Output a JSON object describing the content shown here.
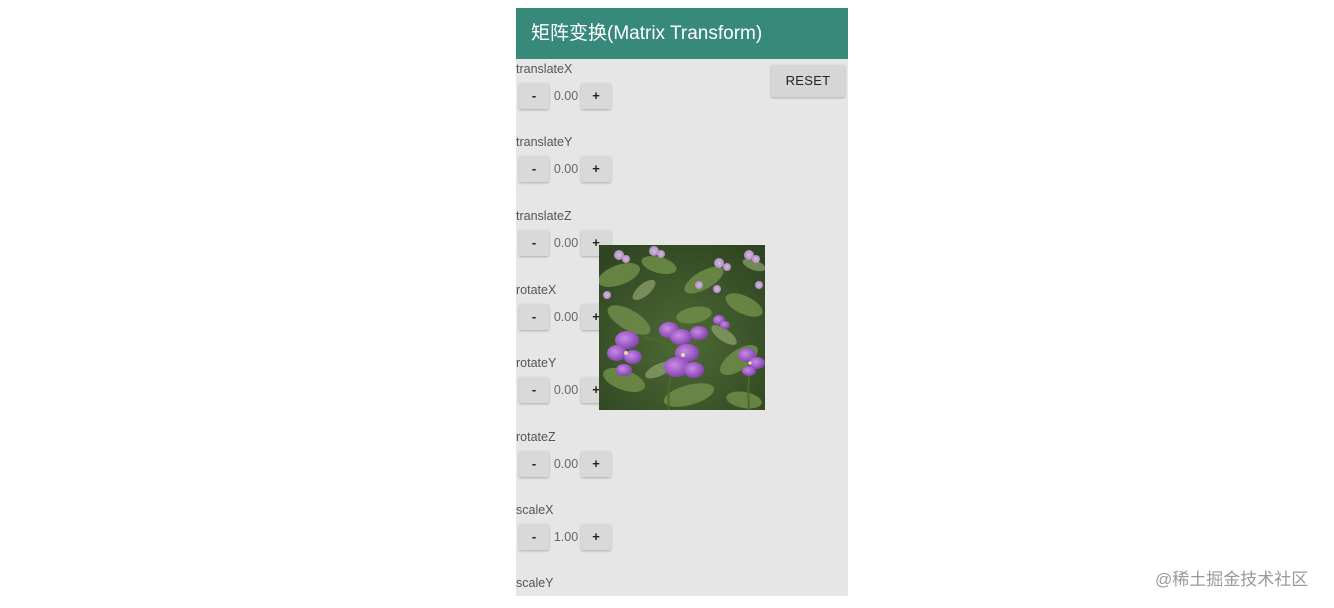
{
  "app": {
    "title": "矩阵变换(Matrix Transform)",
    "accent_color": "#37897a",
    "background_color": "#e6e6e6"
  },
  "toolbar": {
    "reset_label": "RESET"
  },
  "controls": [
    {
      "label": "translateX",
      "value": "0.00",
      "minus": "-",
      "plus": "+"
    },
    {
      "label": "translateY",
      "value": "0.00",
      "minus": "-",
      "plus": "+"
    },
    {
      "label": "translateZ",
      "value": "0.00",
      "minus": "-",
      "plus": "+"
    },
    {
      "label": "rotateX",
      "value": "0.00",
      "minus": "-",
      "plus": "+"
    },
    {
      "label": "rotateY",
      "value": "0.00",
      "minus": "-",
      "plus": "+"
    },
    {
      "label": "rotateZ",
      "value": "0.00",
      "minus": "-",
      "plus": "+"
    },
    {
      "label": "scaleX",
      "value": "1.00",
      "minus": "-",
      "plus": "+"
    },
    {
      "label": "scaleY"
    }
  ],
  "image": {
    "subject": "purple-flowers-photo"
  },
  "watermark": {
    "text": "@稀土掘金技术社区"
  }
}
